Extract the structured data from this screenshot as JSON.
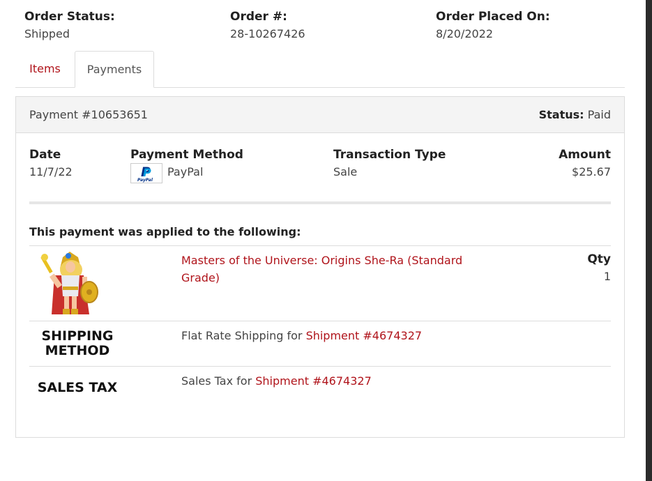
{
  "summary": {
    "status_label": "Order Status:",
    "status_value": "Shipped",
    "order_label": "Order #:",
    "order_value": "28-10267426",
    "placed_label": "Order Placed On:",
    "placed_value": "8/20/2022"
  },
  "tabs": [
    {
      "label": "Items",
      "active": false
    },
    {
      "label": "Payments",
      "active": true
    }
  ],
  "payment": {
    "title": "Payment #10653651",
    "status_label": "Status:",
    "status_value": "Paid",
    "date_label": "Date",
    "date_value": "11/7/22",
    "method_label": "Payment Method",
    "method_value": "PayPal",
    "method_icon": "paypal-icon",
    "type_label": "Transaction Type",
    "type_value": "Sale",
    "amount_label": "Amount",
    "amount_value": "$25.67"
  },
  "applied": {
    "title": "This payment was applied to the following:",
    "product": {
      "name": "Masters of the Universe: Origins She-Ra (Standard Grade)",
      "name_line1": "Masters of the Universe: Origins She-Ra (Standard",
      "name_line2": "Grade)",
      "qty_label": "Qty",
      "qty_value": "1",
      "image": "she-ra-figure-image"
    },
    "shipping": {
      "image_text_line1": "SHIPPING",
      "image_text_line2": "METHOD",
      "text": "Flat Rate Shipping for ",
      "link": "Shipment #4674327"
    },
    "tax": {
      "image_text": "SALES TAX",
      "text": "Sales Tax for ",
      "link": "Shipment #4674327"
    }
  },
  "colors": {
    "link": "#b0141b",
    "header_bg": "#f4f4f4",
    "border": "#dcdcdc"
  }
}
